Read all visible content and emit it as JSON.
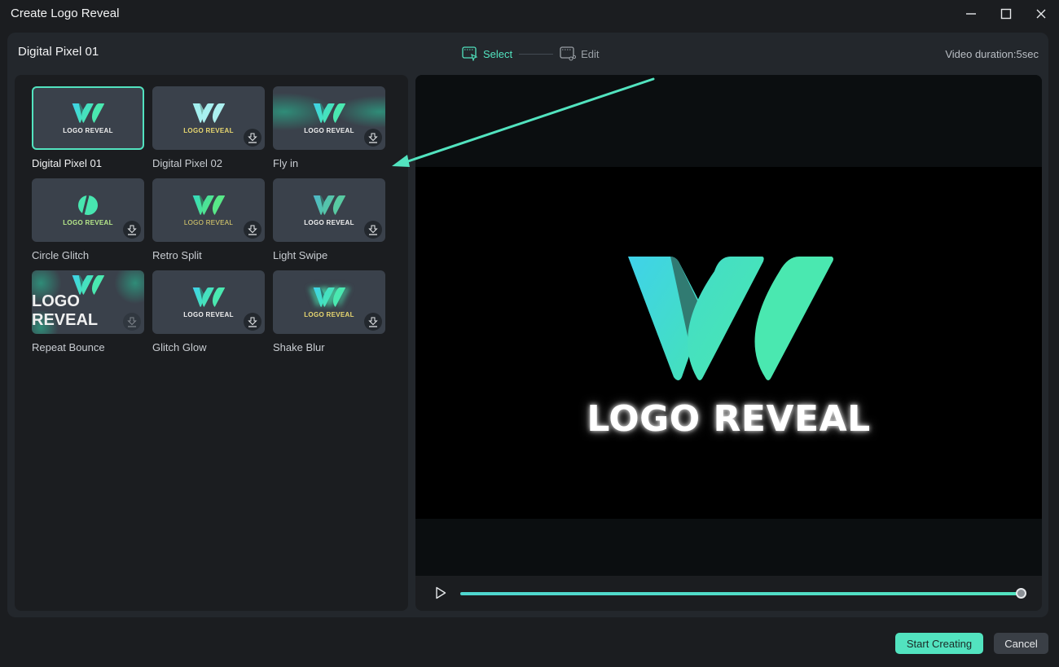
{
  "window": {
    "title": "Create Logo Reveal",
    "controls": [
      "minimize",
      "maximize",
      "close"
    ]
  },
  "header": {
    "template_name": "Digital Pixel 01",
    "steps": [
      {
        "label": "Select",
        "icon": "select-template-icon",
        "active": true
      },
      {
        "label": "Edit",
        "icon": "edit-template-icon",
        "active": false
      }
    ],
    "duration": "Video duration:5sec"
  },
  "templates": [
    {
      "label": "Digital Pixel 01",
      "thumb_text": "LOGO REVEAL",
      "selected": true,
      "downloadable": false
    },
    {
      "label": "Digital Pixel 02",
      "thumb_text": "LOGO  REVEAL",
      "selected": false,
      "downloadable": true
    },
    {
      "label": "Fly in",
      "thumb_text": "LOGO REVEAL",
      "selected": false,
      "downloadable": true
    },
    {
      "label": "Circle Glitch",
      "thumb_text": "LOGO REVEAL",
      "selected": false,
      "downloadable": true
    },
    {
      "label": "Retro Split",
      "thumb_text": "LOGO REVEAL",
      "selected": false,
      "downloadable": true
    },
    {
      "label": "Light Swipe",
      "thumb_text": "LOGO REVEAL",
      "selected": false,
      "downloadable": true
    },
    {
      "label": "Repeat Bounce",
      "thumb_text": "LOGO REVEAL",
      "selected": false,
      "downloadable": true
    },
    {
      "label": "Glitch Glow",
      "thumb_text": "LOGO  REVEAL",
      "selected": false,
      "downloadable": true
    },
    {
      "label": "Shake Blur",
      "thumb_text": "LOGO REVEAL",
      "selected": false,
      "downloadable": true
    }
  ],
  "preview": {
    "logo_text": "LOGO REVEAL",
    "progress": 1.0
  },
  "footer": {
    "primary_label": "Start Creating",
    "cancel_label": "Cancel"
  },
  "colors": {
    "accent": "#52e3bf",
    "logo_cyan": "#3fd0e6",
    "logo_green": "#48e6b0"
  }
}
